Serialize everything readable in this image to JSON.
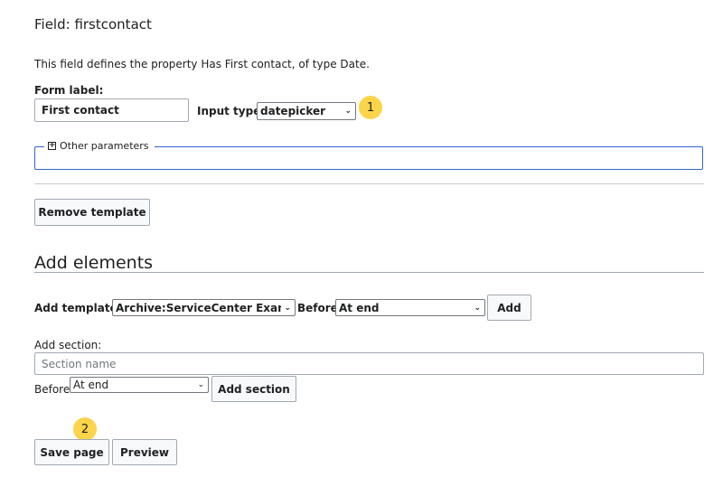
{
  "field": {
    "title": "Field: firstcontact",
    "description": "This field defines the property Has First contact, of type Date."
  },
  "form_label": {
    "label": "Form label:",
    "value": "First contact"
  },
  "input_type": {
    "label": "Input type:",
    "selected": "datepicker"
  },
  "badges": {
    "one": "1",
    "two": "2",
    "color": "#fbd44a"
  },
  "other_parameters": {
    "legend": "Other parameters",
    "icon": "plus-square-icon"
  },
  "remove_template_button": "Remove template",
  "add_elements": {
    "heading": "Add elements",
    "add_template_label": "Add template:",
    "template_selected": "Archive:ServiceCenter Example",
    "before_label": "Before:",
    "before_selected": "At end",
    "add_button": "Add",
    "add_section_label": "Add section:",
    "section_name_placeholder": "Section name",
    "section_before_label": "Before:",
    "section_before_selected": "At end",
    "add_section_button": "Add section"
  },
  "actions": {
    "save_button": "Save page",
    "preview_button": "Preview"
  }
}
